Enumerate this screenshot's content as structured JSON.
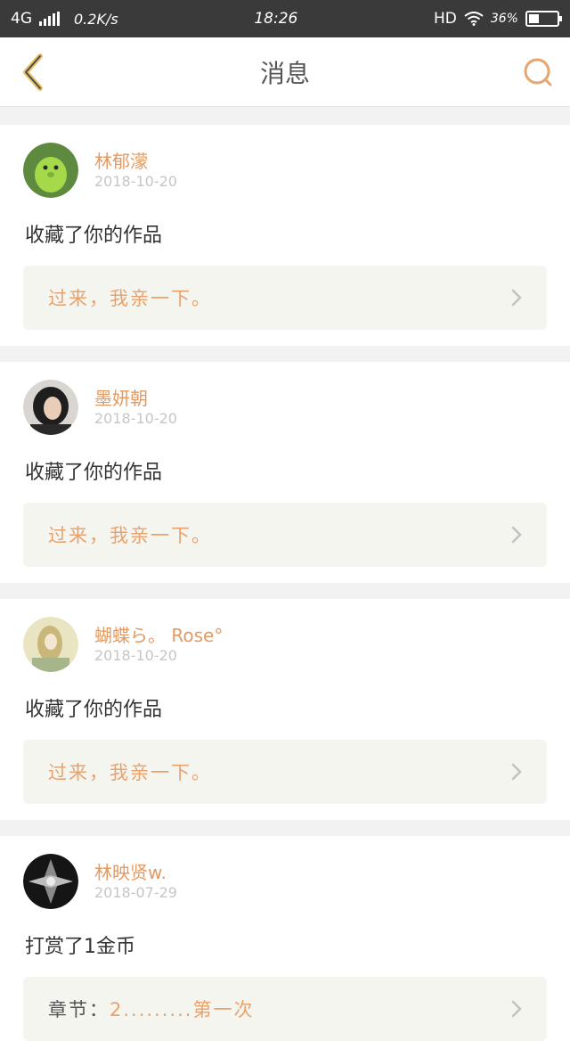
{
  "status_bar": {
    "network": "4G",
    "speed": "0.2K/s",
    "time": "18:26",
    "hd": "HD",
    "battery_text": "36%",
    "battery_level": 0.36
  },
  "header": {
    "title": "消息",
    "back_icon": "chevron-left-icon",
    "search_icon": "search-icon",
    "accent_color": "#e7a56f"
  },
  "messages": [
    {
      "name": "林郁濛",
      "date": "2018-10-20",
      "action": "收藏了你的作品",
      "link_prefix": "",
      "link_text": "过来，我亲一下。",
      "avatar_icon": "green-character-avatar"
    },
    {
      "name": "墨妍朝",
      "date": "2018-10-20",
      "action": "收藏了你的作品",
      "link_prefix": "",
      "link_text": "过来，我亲一下。",
      "avatar_icon": "woman-portrait-avatar"
    },
    {
      "name": "蝴蝶ら。 Rose°",
      "date": "2018-10-20",
      "action": "收藏了你的作品",
      "link_prefix": "",
      "link_text": "过来，我亲一下。",
      "avatar_icon": "girl-illustration-avatar"
    },
    {
      "name": "林映贤w.",
      "date": "2018-07-29",
      "action": "打赏了1金币",
      "link_prefix": "章节：",
      "link_text": "2.........第一次",
      "avatar_icon": "dark-abstract-avatar"
    }
  ]
}
